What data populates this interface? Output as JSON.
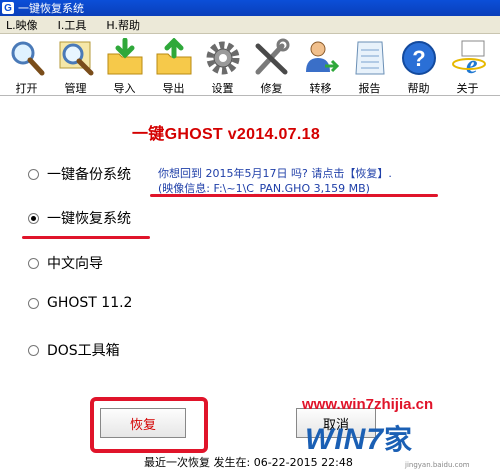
{
  "window": {
    "title": "一键恢复系统"
  },
  "menu": [
    "L.映像",
    "I.工具",
    "H.帮助"
  ],
  "toolbar": [
    {
      "label": "打开",
      "icon": "magnifier-open-icon"
    },
    {
      "label": "管理",
      "icon": "magnifier-manage-icon"
    },
    {
      "label": "导入",
      "icon": "folder-import-icon"
    },
    {
      "label": "导出",
      "icon": "folder-export-icon"
    },
    {
      "label": "设置",
      "icon": "gear-icon"
    },
    {
      "label": "修复",
      "icon": "tools-icon"
    },
    {
      "label": "转移",
      "icon": "user-transfer-icon"
    },
    {
      "label": "报告",
      "icon": "notepad-icon"
    },
    {
      "label": "帮助",
      "icon": "help-icon"
    },
    {
      "label": "关于",
      "icon": "ie-about-icon"
    }
  ],
  "app_title": "一键GHOST v2014.07.18",
  "options": [
    {
      "label": "一键备份系统",
      "checked": false
    },
    {
      "label": "一键恢复系统",
      "checked": true
    },
    {
      "label": "中文向导",
      "checked": false
    },
    {
      "label": "GHOST 11.2",
      "checked": false
    },
    {
      "label": "DOS工具箱",
      "checked": false
    }
  ],
  "info": {
    "line1": "你想回到 2015年5月17日 吗? 请点击【恢复】.",
    "line2": "(映像信息: F:\\~1\\C_PAN.GHO   3,159 MB)"
  },
  "buttons": {
    "restore": "恢复",
    "cancel": "取消"
  },
  "status": "最近一次恢复 发生在: 06-22-2015  22:48",
  "watermark": {
    "site": "www.win7zhijia.cn",
    "logo": "WIN7",
    "logo_suffix": "家",
    "sub": "jingyan.baidu.com"
  },
  "colors": {
    "accent_red": "#e0142a",
    "title_red": "#d40000",
    "info_blue": "#1f3fa8",
    "titlebar": "#0b4fd8"
  }
}
